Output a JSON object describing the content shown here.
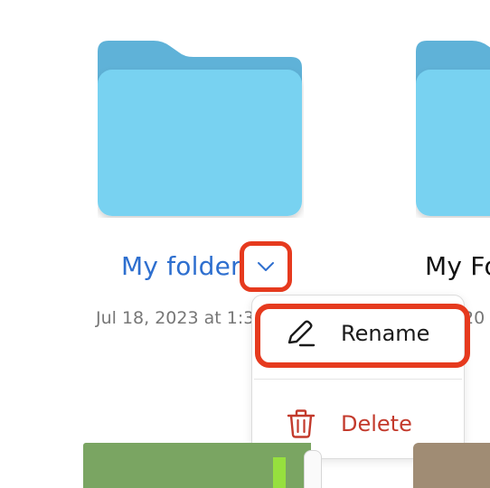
{
  "folders": [
    {
      "name": "My folder",
      "date": "Jul 18, 2023 at 1:3"
    },
    {
      "name": "My Fo",
      "date": "20"
    }
  ],
  "context_menu": {
    "rename_label": "Rename",
    "rename_icon": "pencil-icon",
    "delete_label": "Delete",
    "delete_icon": "trash-icon"
  },
  "colors": {
    "folder_front": "#78d2f1",
    "folder_back": "#5fb2d8",
    "selected_name": "#2e6fcf",
    "highlight": "#e63a1e",
    "delete": "#c33a2c"
  }
}
